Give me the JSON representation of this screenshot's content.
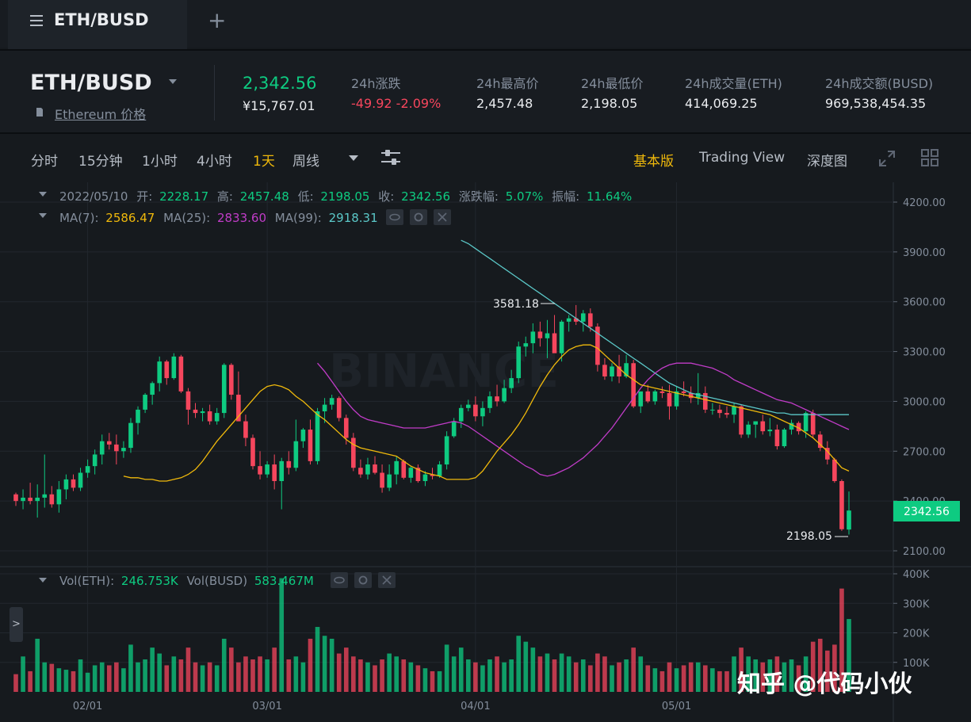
{
  "tab": {
    "menu_icon": "menu-icon",
    "title": "ETH/BUSD",
    "add_icon": "plus-icon"
  },
  "ticker": {
    "symbol": "ETH/BUSD",
    "subtitle": "Ethereum 价格",
    "last_price": "2,342.56",
    "cny_price": "¥15,767.01",
    "stats": [
      {
        "label": "24h涨跌",
        "value": "-49.92 -2.09%",
        "negative": true
      },
      {
        "label": "24h最高价",
        "value": "2,457.48"
      },
      {
        "label": "24h最低价",
        "value": "2,198.05"
      },
      {
        "label": "24h成交量(ETH)",
        "value": "414,069.25"
      },
      {
        "label": "24h成交额(BUSD)",
        "value": "969,538,454.35"
      }
    ]
  },
  "toolbar": {
    "timeframes": [
      "分时",
      "15分钟",
      "1小时",
      "4小时",
      "1天",
      "周线"
    ],
    "active_timeframe": "1天",
    "views": [
      "基本版",
      "Trading View",
      "深度图"
    ],
    "active_view": "基本版"
  },
  "colors": {
    "up": "#0ecb81",
    "down": "#f6465d",
    "accent": "#f0b90b",
    "ma7": "#f0b90b",
    "ma25": "#c13cc8",
    "ma99": "#5bc8c8"
  },
  "chart_data": {
    "type": "candlestick",
    "ohlc_legend": {
      "date": "2022/05/10",
      "open_label": "开:",
      "open": "2228.17",
      "high_label": "高:",
      "high": "2457.48",
      "low_label": "低:",
      "low": "2198.05",
      "close_label": "收:",
      "close": "2342.56",
      "change_label": "涨跌幅:",
      "change": "5.07%",
      "amplitude_label": "振幅:",
      "amplitude": "11.64%"
    },
    "ma_legend": [
      {
        "name": "MA(7):",
        "value": "2586.47"
      },
      {
        "name": "MA(25):",
        "value": "2833.60"
      },
      {
        "name": "MA(99):",
        "value": "2918.31"
      }
    ],
    "vol_legend": [
      {
        "name": "Vol(ETH):",
        "value": "246.753K"
      },
      {
        "name": "Vol(BUSD)",
        "value": "583.467M"
      }
    ],
    "price_ticks": [
      "4200.00",
      "3900.00",
      "3600.00",
      "3300.00",
      "3000.00",
      "2700.00",
      "2400.00",
      "2100.00"
    ],
    "price_range": [
      2100,
      4200
    ],
    "vol_ticks": [
      "400K",
      "300K",
      "200K",
      "100K"
    ],
    "vol_range": [
      0,
      400000
    ],
    "x_ticks": [
      "02/01",
      "03/01",
      "04/01",
      "05/01"
    ],
    "current_price_label": "2342.56",
    "high_marker": "3581.18",
    "low_marker": "2198.05",
    "watermark_text": "BINANCE",
    "last_update_date": "2022/05/10",
    "candles": [
      [
        2440,
        2450,
        2370,
        2400,
        60000
      ],
      [
        2400,
        2470,
        2350,
        2420,
        120000
      ],
      [
        2420,
        2510,
        2380,
        2400,
        70000
      ],
      [
        2400,
        2500,
        2300,
        2420,
        180000
      ],
      [
        2420,
        2680,
        2360,
        2440,
        100000
      ],
      [
        2440,
        2490,
        2360,
        2380,
        95000
      ],
      [
        2380,
        2520,
        2330,
        2470,
        80000
      ],
      [
        2470,
        2560,
        2410,
        2530,
        75000
      ],
      [
        2530,
        2560,
        2460,
        2480,
        70000
      ],
      [
        2480,
        2600,
        2460,
        2570,
        110000
      ],
      [
        2570,
        2650,
        2540,
        2610,
        65000
      ],
      [
        2610,
        2710,
        2560,
        2680,
        90000
      ],
      [
        2680,
        2800,
        2620,
        2760,
        100000
      ],
      [
        2760,
        2810,
        2710,
        2740,
        90000
      ],
      [
        2740,
        2800,
        2620,
        2700,
        100000
      ],
      [
        2700,
        2760,
        2660,
        2720,
        80000
      ],
      [
        2720,
        2900,
        2690,
        2870,
        160000
      ],
      [
        2870,
        2970,
        2800,
        2950,
        100000
      ],
      [
        2950,
        3050,
        2930,
        3040,
        110000
      ],
      [
        3040,
        3120,
        2980,
        3110,
        150000
      ],
      [
        3110,
        3270,
        3060,
        3240,
        130000
      ],
      [
        3240,
        3250,
        3100,
        3140,
        90000
      ],
      [
        3140,
        3290,
        3130,
        3270,
        120000
      ],
      [
        3270,
        3280,
        3050,
        3060,
        110000
      ],
      [
        3060,
        3080,
        2860,
        2950,
        150000
      ],
      [
        2950,
        2990,
        2900,
        2930,
        100000
      ],
      [
        2930,
        2960,
        2880,
        2940,
        90000
      ],
      [
        2940,
        2980,
        2860,
        2880,
        100000
      ],
      [
        2880,
        2960,
        2860,
        2930,
        90000
      ],
      [
        2930,
        3230,
        2900,
        3220,
        180000
      ],
      [
        3220,
        3230,
        3010,
        3040,
        150000
      ],
      [
        3040,
        3180,
        2880,
        2880,
        100000
      ],
      [
        2880,
        2920,
        2730,
        2780,
        120000
      ],
      [
        2780,
        2800,
        2590,
        2610,
        110000
      ],
      [
        2610,
        2700,
        2530,
        2560,
        120000
      ],
      [
        2560,
        2640,
        2540,
        2620,
        110000
      ],
      [
        2620,
        2680,
        2470,
        2520,
        150000
      ],
      [
        2520,
        2660,
        2350,
        2640,
        385000
      ],
      [
        2640,
        2700,
        2560,
        2600,
        110000
      ],
      [
        2600,
        2890,
        2580,
        2760,
        120000
      ],
      [
        2760,
        2840,
        2720,
        2830,
        100000
      ],
      [
        2830,
        2890,
        2620,
        2640,
        180000
      ],
      [
        2640,
        2960,
        2620,
        2940,
        220000
      ],
      [
        2940,
        3020,
        2870,
        2980,
        190000
      ],
      [
        2980,
        3040,
        2950,
        3020,
        180000
      ],
      [
        3020,
        3030,
        2880,
        2900,
        130000
      ],
      [
        2900,
        2920,
        2740,
        2780,
        150000
      ],
      [
        2780,
        2810,
        2580,
        2600,
        120000
      ],
      [
        2600,
        2650,
        2540,
        2560,
        110000
      ],
      [
        2560,
        2660,
        2530,
        2620,
        100000
      ],
      [
        2620,
        2670,
        2560,
        2570,
        90000
      ],
      [
        2570,
        2620,
        2450,
        2480,
        110000
      ],
      [
        2480,
        2620,
        2460,
        2560,
        130000
      ],
      [
        2560,
        2670,
        2500,
        2640,
        120000
      ],
      [
        2640,
        2650,
        2530,
        2540,
        110000
      ],
      [
        2540,
        2610,
        2510,
        2600,
        100000
      ],
      [
        2600,
        2620,
        2510,
        2520,
        90000
      ],
      [
        2520,
        2580,
        2490,
        2560,
        80000
      ],
      [
        2560,
        2600,
        2530,
        2550,
        70000
      ],
      [
        2550,
        2640,
        2540,
        2620,
        70000
      ],
      [
        2620,
        2820,
        2590,
        2790,
        160000
      ],
      [
        2790,
        2900,
        2780,
        2880,
        120000
      ],
      [
        2880,
        2980,
        2840,
        2960,
        150000
      ],
      [
        2960,
        3010,
        2940,
        2980,
        110000
      ],
      [
        2980,
        3030,
        2880,
        2910,
        100000
      ],
      [
        2910,
        3000,
        2850,
        2960,
        90000
      ],
      [
        2960,
        3060,
        2930,
        3030,
        110000
      ],
      [
        3030,
        3100,
        2970,
        3000,
        120000
      ],
      [
        3000,
        3130,
        2990,
        3080,
        100000
      ],
      [
        3080,
        3190,
        3050,
        3140,
        110000
      ],
      [
        3140,
        3360,
        3110,
        3330,
        190000
      ],
      [
        3330,
        3390,
        3270,
        3350,
        170000
      ],
      [
        3350,
        3470,
        3290,
        3420,
        150000
      ],
      [
        3420,
        3480,
        3330,
        3380,
        120000
      ],
      [
        3380,
        3490,
        3260,
        3410,
        130000
      ],
      [
        3410,
        3520,
        3340,
        3290,
        110000
      ],
      [
        3290,
        3490,
        3240,
        3480,
        130000
      ],
      [
        3480,
        3520,
        3420,
        3500,
        120000
      ],
      [
        3500,
        3580,
        3460,
        3480,
        100000
      ],
      [
        3480,
        3550,
        3420,
        3530,
        110000
      ],
      [
        3530,
        3560,
        3420,
        3450,
        90000
      ],
      [
        3450,
        3470,
        3180,
        3220,
        130000
      ],
      [
        3220,
        3260,
        3130,
        3150,
        120000
      ],
      [
        3150,
        3230,
        3120,
        3210,
        90000
      ],
      [
        3210,
        3280,
        3110,
        3150,
        100000
      ],
      [
        3150,
        3280,
        3140,
        3230,
        110000
      ],
      [
        3230,
        3250,
        2960,
        2970,
        150000
      ],
      [
        2970,
        3050,
        2930,
        3060,
        120000
      ],
      [
        3060,
        3100,
        2990,
        3000,
        90000
      ],
      [
        3000,
        3070,
        2980,
        3060,
        80000
      ],
      [
        3060,
        3090,
        3020,
        3050,
        70000
      ],
      [
        3050,
        3100,
        2890,
        2970,
        100000
      ],
      [
        2970,
        3090,
        2950,
        3060,
        80000
      ],
      [
        3060,
        3120,
        3030,
        3050,
        90000
      ],
      [
        3050,
        3090,
        2990,
        3020,
        100000
      ],
      [
        3020,
        3170,
        2980,
        3050,
        100000
      ],
      [
        3050,
        3090,
        2930,
        2950,
        90000
      ],
      [
        2950,
        2990,
        2920,
        2950,
        80000
      ],
      [
        2950,
        2980,
        2900,
        2930,
        70000
      ],
      [
        2930,
        2970,
        2900,
        2920,
        70000
      ],
      [
        2920,
        2990,
        2870,
        2970,
        120000
      ],
      [
        2970,
        2980,
        2780,
        2800,
        150000
      ],
      [
        2800,
        2880,
        2780,
        2860,
        120000
      ],
      [
        2860,
        2880,
        2780,
        2880,
        110000
      ],
      [
        2880,
        2920,
        2800,
        2820,
        100000
      ],
      [
        2820,
        2900,
        2790,
        2830,
        110000
      ],
      [
        2830,
        2860,
        2710,
        2730,
        120000
      ],
      [
        2730,
        2840,
        2720,
        2830,
        100000
      ],
      [
        2830,
        2890,
        2800,
        2870,
        110000
      ],
      [
        2870,
        2880,
        2800,
        2820,
        90000
      ],
      [
        2820,
        2940,
        2780,
        2930,
        120000
      ],
      [
        2930,
        2950,
        2780,
        2800,
        170000
      ],
      [
        2800,
        2820,
        2700,
        2720,
        180000
      ],
      [
        2720,
        2760,
        2620,
        2650,
        140000
      ],
      [
        2650,
        2660,
        2510,
        2520,
        160000
      ],
      [
        2520,
        2530,
        2220,
        2230,
        350000
      ],
      [
        2228.17,
        2457.48,
        2198.05,
        2342.56,
        246753
      ]
    ],
    "ma7": [
      2550,
      2540,
      2540,
      2530,
      2530,
      2520,
      2520,
      2530,
      2540,
      2560,
      2590,
      2640,
      2700,
      2760,
      2810,
      2860,
      2910,
      2960,
      3010,
      3060,
      3090,
      3100,
      3090,
      3070,
      3030,
      3000,
      2960,
      2920,
      2890,
      2850,
      2810,
      2770,
      2740,
      2720,
      2710,
      2700,
      2690,
      2680,
      2670,
      2640,
      2610,
      2590,
      2570,
      2560,
      2550,
      2530,
      2530,
      2530,
      2530,
      2540,
      2580,
      2640,
      2700,
      2750,
      2800,
      2860,
      2930,
      3010,
      3090,
      3160,
      3220,
      3270,
      3310,
      3330,
      3340,
      3340,
      3320,
      3280,
      3240,
      3200,
      3160,
      3130,
      3100,
      3090,
      3080,
      3070,
      3060,
      3050,
      3040,
      3030,
      3020,
      3010,
      3000,
      2990,
      2980,
      2970,
      2960,
      2950,
      2940,
      2930,
      2920,
      2900,
      2880,
      2860,
      2840,
      2810,
      2780,
      2740,
      2700,
      2650,
      2600,
      2580
    ],
    "ma25": [
      3230,
      3180,
      3120,
      3060,
      3000,
      2950,
      2910,
      2890,
      2880,
      2870,
      2860,
      2850,
      2840,
      2840,
      2840,
      2840,
      2850,
      2860,
      2870,
      2880,
      2870,
      2850,
      2820,
      2790,
      2760,
      2730,
      2700,
      2670,
      2640,
      2610,
      2590,
      2560,
      2550,
      2560,
      2580,
      2600,
      2630,
      2660,
      2700,
      2740,
      2790,
      2840,
      2900,
      2960,
      3020,
      3080,
      3130,
      3170,
      3200,
      3220,
      3230,
      3230,
      3230,
      3220,
      3210,
      3200,
      3180,
      3160,
      3130,
      3110,
      3090,
      3070,
      3050,
      3030,
      3010,
      3000,
      2990,
      2970,
      2950,
      2930,
      2910,
      2890,
      2870,
      2850,
      2830
    ],
    "ma99": [
      3970,
      3950,
      3920,
      3890,
      3860,
      3830,
      3800,
      3770,
      3740,
      3710,
      3680,
      3650,
      3620,
      3590,
      3560,
      3530,
      3500,
      3470,
      3440,
      3410,
      3380,
      3350,
      3320,
      3290,
      3260,
      3230,
      3200,
      3170,
      3140,
      3110,
      3090,
      3070,
      3050,
      3040,
      3030,
      3020,
      3010,
      3000,
      2990,
      2980,
      2970,
      2960,
      2950,
      2940,
      2930,
      2930,
      2920,
      2920,
      2920,
      2920,
      2920,
      2920,
      2920,
      2920,
      2920
    ]
  },
  "watermark": "知乎 @代码小伙"
}
